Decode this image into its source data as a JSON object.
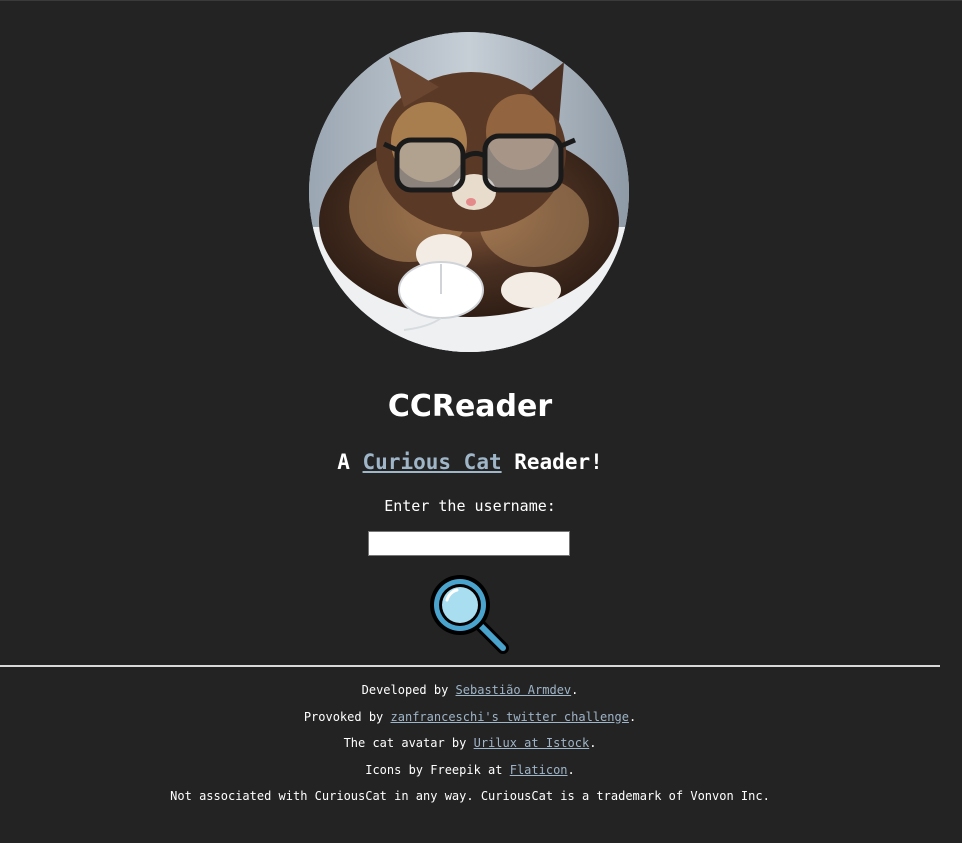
{
  "header": {
    "avatar_icon": "cat-with-glasses-avatar",
    "title": "CCReader"
  },
  "subtitle": {
    "prefix": "A ",
    "link_label": "Curious Cat",
    "suffix": " Reader!"
  },
  "search": {
    "prompt": "Enter the username:",
    "input_value": "",
    "button_icon": "magnifying-glass-icon"
  },
  "footer": {
    "developed_prefix": "Developed by ",
    "developer_link": "Sebastião Armdev",
    "developed_suffix": ".",
    "provoked_prefix": "Provoked by ",
    "provoked_link": "zanfranceschi's twitter challenge",
    "provoked_suffix": ".",
    "avatar_prefix": "The cat avatar by ",
    "avatar_link": "Urilux at Istock",
    "avatar_suffix": ".",
    "icons_prefix": "Icons by Freepik at ",
    "icons_link": "Flaticon",
    "icons_suffix": ".",
    "disclaimer": "Not associated with CuriousCat in any way. CuriousCat is a trademark of Vonvon Inc."
  },
  "colors": {
    "background": "#232323",
    "text": "#ffffff",
    "link": "#9fb5c8",
    "divider": "#d8d8d8",
    "magnifier_lens": "#a9ddf0"
  }
}
